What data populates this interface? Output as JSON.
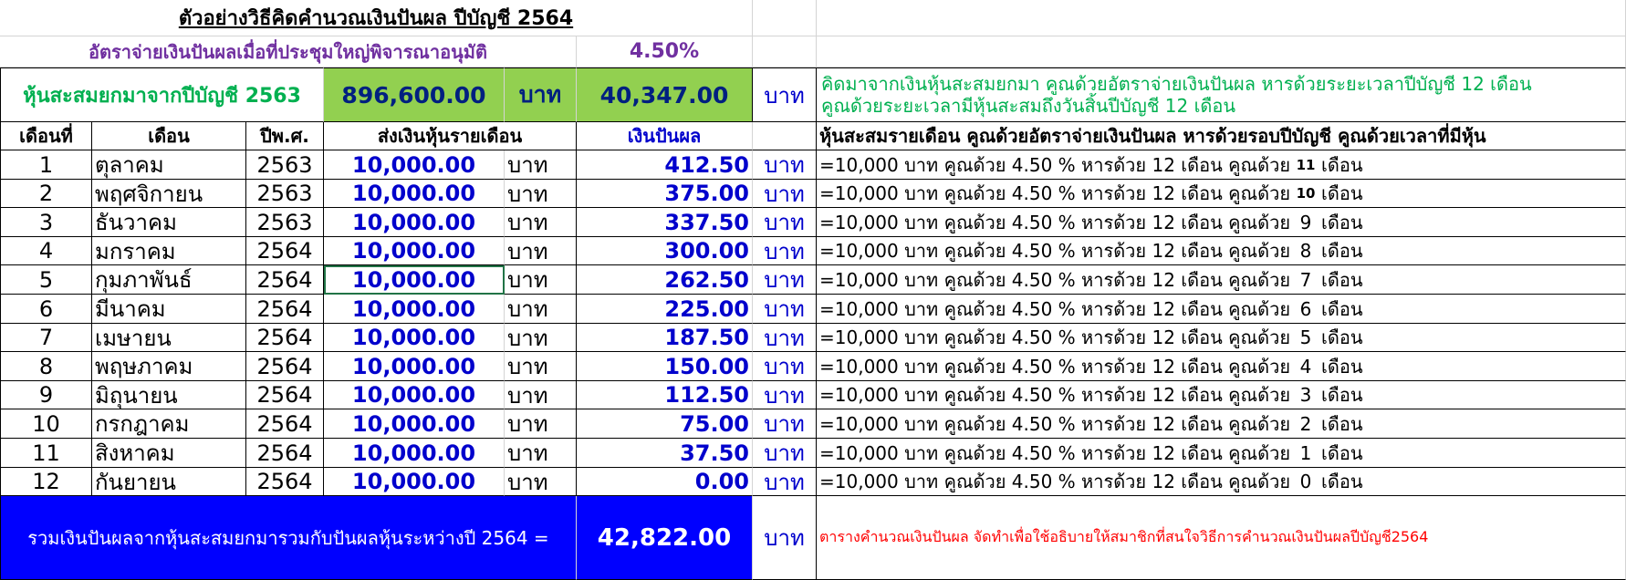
{
  "sheet": {
    "title": "ตัวอย่างวิธีคิดคำนวณเงินปันผล ปีบัญชี 2564",
    "rate_label": "อัตราจ่ายเงินปันผลเมื่อที่ประชุมใหญ่พิจารณาอนุมัติ",
    "rate_value": "4.50%",
    "carry_label": "หุ้นสะสมยกมาจากปีบัญชี 2563",
    "carry_amount": "896,600.00",
    "carry_unit": "บาท",
    "carry_dividend": "40,347.00",
    "carry_dividend_unit": "บาท",
    "carry_note_line1": "คิดมาจากเงินหุ้นสะสมยกมา คูณด้วยอัตราจ่ายเงินปันผล หารด้วยระยะเวลาปีบัญชี 12 เดือน",
    "carry_note_line2": "คูณด้วยระยะเวลามีหุ้นสะสมถึงวันสิ้นปีบัญชี 12 เดือน",
    "headers": {
      "no": "เดือนที่",
      "month": "เดือน",
      "year": "ปีพ.ศ.",
      "deposit": "ส่งเงินหุ้นรายเดือน",
      "dividend": "เงินปันผล",
      "formula": "หุ้นสะสมรายเดือน คูณด้วยอัตราจ่ายเงินปันผล หารด้วยรอบปีบัญชี คูณด้วยเวลาที่มีหุ้น"
    },
    "rows": [
      {
        "no": "1",
        "month": "ตุลาคม",
        "year": "2563",
        "deposit": "10,000.00",
        "unit": "บาท",
        "dividend": "412.50",
        "dunit": "บาท",
        "formula": "=10,000 บาท คูณด้วย 4.50 % หารด้วย 12 เดือน คูณด้วย",
        "months": "11",
        "mword": "เดือน"
      },
      {
        "no": "2",
        "month": "พฤศจิกายน",
        "year": "2563",
        "deposit": "10,000.00",
        "unit": "บาท",
        "dividend": "375.00",
        "dunit": "บาท",
        "formula": "=10,000 บาท คูณด้วย 4.50 % หารด้วย 12 เดือน คูณด้วย",
        "months": "10",
        "mword": "เดือน"
      },
      {
        "no": "3",
        "month": "ธันวาคม",
        "year": "2563",
        "deposit": "10,000.00",
        "unit": "บาท",
        "dividend": "337.50",
        "dunit": "บาท",
        "formula": "=10,000 บาท คูณด้วย 4.50 % หารด้วย 12 เดือน คูณด้วย",
        "months": "9",
        "mword": "เดือน"
      },
      {
        "no": "4",
        "month": "มกราคม",
        "year": "2564",
        "deposit": "10,000.00",
        "unit": "บาท",
        "dividend": "300.00",
        "dunit": "บาท",
        "formula": "=10,000 บาท คูณด้วย 4.50 % หารด้วย 12 เดือน คูณด้วย",
        "months": "8",
        "mword": "เดือน"
      },
      {
        "no": "5",
        "month": "กุมภาพันธ์",
        "year": "2564",
        "deposit": "10,000.00",
        "unit": "บาท",
        "dividend": "262.50",
        "dunit": "บาท",
        "formula": "=10,000 บาท คูณด้วย 4.50 % หารด้วย 12 เดือน คูณด้วย",
        "months": "7",
        "mword": "เดือน"
      },
      {
        "no": "6",
        "month": "มีนาคม",
        "year": "2564",
        "deposit": "10,000.00",
        "unit": "บาท",
        "dividend": "225.00",
        "dunit": "บาท",
        "formula": "=10,000 บาท คูณด้วย 4.50 % หารด้วย 12 เดือน คูณด้วย",
        "months": "6",
        "mword": "เดือน"
      },
      {
        "no": "7",
        "month": "เมษายน",
        "year": "2564",
        "deposit": "10,000.00",
        "unit": "บาท",
        "dividend": "187.50",
        "dunit": "บาท",
        "formula": "=10,000 บาท คูณด้วย 4.50 % หารด้วย 12 เดือน คูณด้วย",
        "months": "5",
        "mword": "เดือน"
      },
      {
        "no": "8",
        "month": "พฤษภาคม",
        "year": "2564",
        "deposit": "10,000.00",
        "unit": "บาท",
        "dividend": "150.00",
        "dunit": "บาท",
        "formula": "=10,000 บาท คูณด้วย 4.50 % หารด้วย 12 เดือน คูณด้วย",
        "months": "4",
        "mword": "เดือน"
      },
      {
        "no": "9",
        "month": "มิถุนายน",
        "year": "2564",
        "deposit": "10,000.00",
        "unit": "บาท",
        "dividend": "112.50",
        "dunit": "บาท",
        "formula": "=10,000 บาท คูณด้วย 4.50 % หารด้วย 12 เดือน คูณด้วย",
        "months": "3",
        "mword": "เดือน"
      },
      {
        "no": "10",
        "month": "กรกฎาคม",
        "year": "2564",
        "deposit": "10,000.00",
        "unit": "บาท",
        "dividend": "75.00",
        "dunit": "บาท",
        "formula": "=10,000 บาท คูณด้วย 4.50 % หารด้วย 12 เดือน คูณด้วย",
        "months": "2",
        "mword": "เดือน"
      },
      {
        "no": "11",
        "month": "สิงหาคม",
        "year": "2564",
        "deposit": "10,000.00",
        "unit": "บาท",
        "dividend": "37.50",
        "dunit": "บาท",
        "formula": "=10,000 บาท คูณด้วย 4.50 % หารด้วย 12 เดือน คูณด้วย",
        "months": "1",
        "mword": "เดือน"
      },
      {
        "no": "12",
        "month": "กันยายน",
        "year": "2564",
        "deposit": "10,000.00",
        "unit": "บาท",
        "dividend": "0.00",
        "dunit": "บาท",
        "formula": "=10,000 บาท คูณด้วย 4.50 % หารด้วย 12 เดือน คูณด้วย",
        "months": "0",
        "mword": "เดือน"
      }
    ],
    "total_label": "รวมเงินปันผลจากหุ้นสะสมยกมารวมกับปันผลหุ้นระหว่างปี 2564 =",
    "total_value": "42,822.00",
    "total_unit": "บาท",
    "footer_note": "ตารางคำนวณเงินปันผล จัดทำเพื่อใช้อธิบายให้สมาชิกที่สนใจวิธีการคำนวณเงินปันผลปีบัญชี2564"
  }
}
